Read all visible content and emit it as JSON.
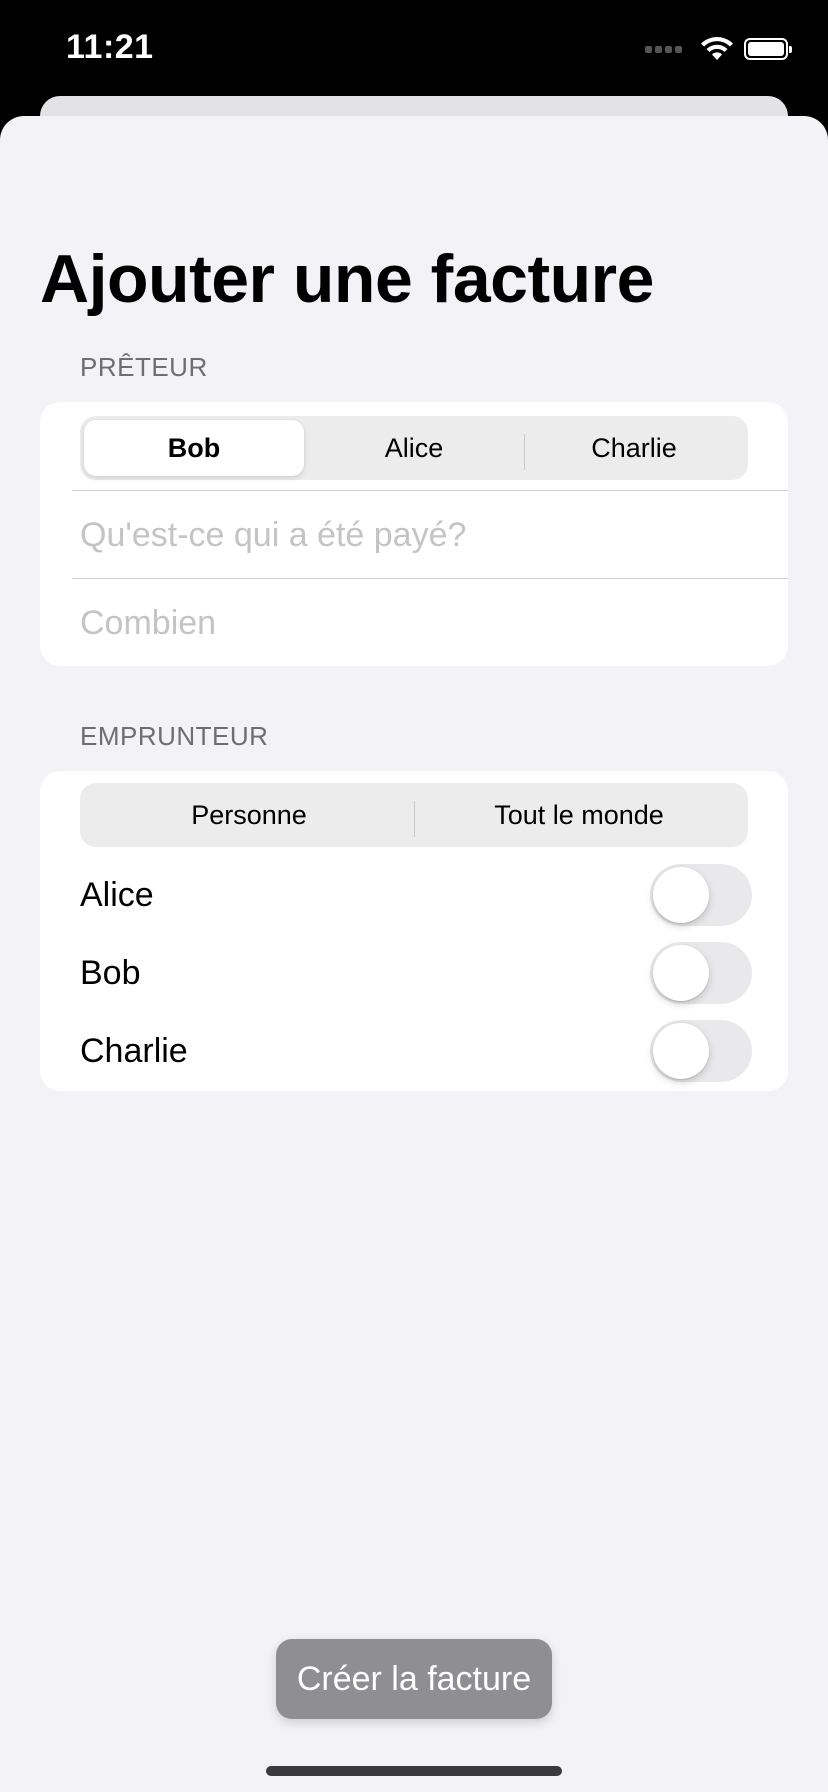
{
  "status_bar": {
    "time": "11:21"
  },
  "page": {
    "title": "Ajouter une facture"
  },
  "lender_section": {
    "header": "PRÊTEUR",
    "segments": [
      "Bob",
      "Alice",
      "Charlie"
    ],
    "selected": "Bob",
    "what_field": {
      "value": "",
      "placeholder": "Qu'est-ce qui a été payé?"
    },
    "amount_field": {
      "value": "",
      "placeholder": "Combien"
    }
  },
  "borrower_section": {
    "header": "EMPRUNTEUR",
    "segments": [
      "Personne",
      "Tout le monde"
    ],
    "toggles": [
      {
        "label": "Alice",
        "on": false
      },
      {
        "label": "Bob",
        "on": false
      },
      {
        "label": "Charlie",
        "on": false
      }
    ]
  },
  "actions": {
    "create_label": "Créer la facture"
  },
  "icons": [
    "signal-icon",
    "wifi-icon",
    "battery-icon"
  ],
  "colors": {
    "background": "#f2f2f7",
    "card": "#ffffff",
    "secondary_text": "#6d6d72",
    "disabled_button": "#8e8e93",
    "toggle_off": "#e9e9eb"
  }
}
